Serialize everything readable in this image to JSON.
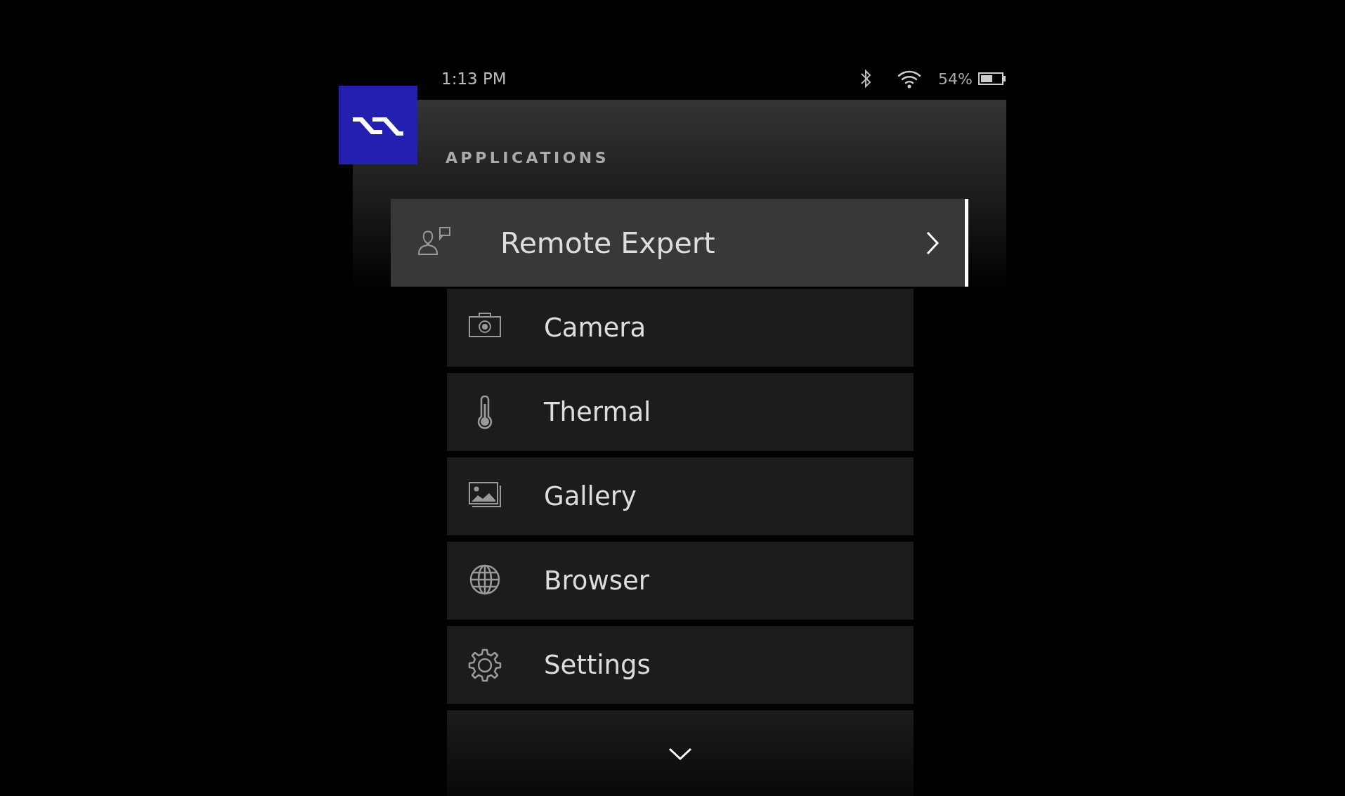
{
  "status_bar": {
    "time": "1:13 PM",
    "battery_text": "54%"
  },
  "header": {
    "title": "APPLICATIONS"
  },
  "items": [
    {
      "label": "Remote Expert",
      "kind": "expert",
      "selected": true
    },
    {
      "label": "Camera",
      "kind": "camera",
      "selected": false
    },
    {
      "label": "Thermal",
      "kind": "thermal",
      "selected": false
    },
    {
      "label": "Gallery",
      "kind": "gallery",
      "selected": false
    },
    {
      "label": "Browser",
      "kind": "browser",
      "selected": false
    },
    {
      "label": "Settings",
      "kind": "settings",
      "selected": false
    }
  ]
}
